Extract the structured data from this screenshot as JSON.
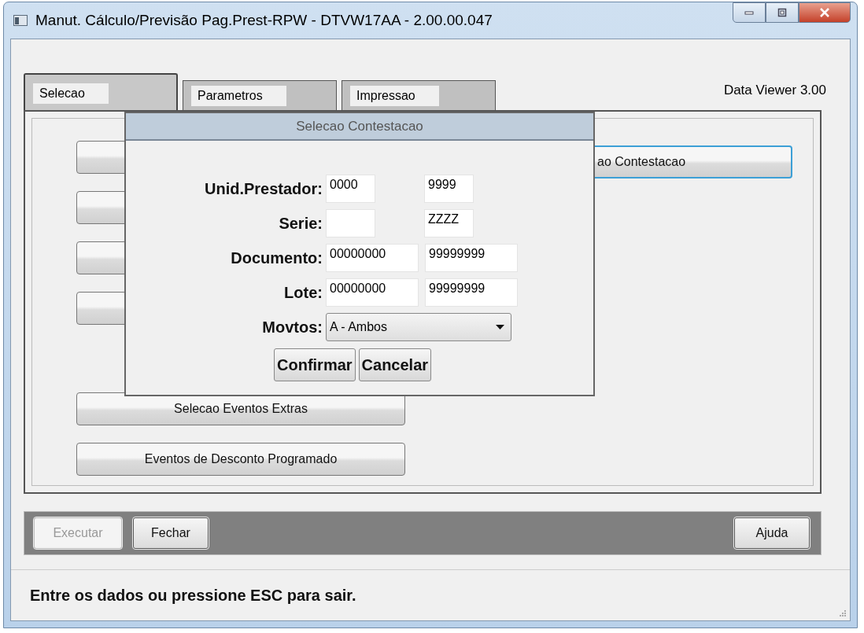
{
  "window": {
    "title": "Manut. Cálculo/Previsão Pag.Prest-RPW - DTVW17AA - 2.00.00.047"
  },
  "tabs": [
    {
      "label": "Selecao",
      "selected": true
    },
    {
      "label": "Parametros",
      "selected": false
    },
    {
      "label": "Impressao",
      "selected": false
    }
  ],
  "version": "Data Viewer 3.00",
  "panel_buttons_left": [
    {
      "label": "Selecao Eventos Extras"
    },
    {
      "label": "Eventos de Desconto Programado"
    }
  ],
  "panel_button_right": {
    "label": "ao Contestacao",
    "focused": true
  },
  "dialog": {
    "title": "Selecao Contestacao",
    "fields": [
      {
        "label": "Unid.Prestador:",
        "from": "0000",
        "to": "9999"
      },
      {
        "label": "Serie:",
        "to": "ZZZZ"
      },
      {
        "label": "Documento:",
        "from": "00000000",
        "to": "99999999"
      },
      {
        "label": "Lote:",
        "from": "00000000",
        "to": "99999999"
      }
    ],
    "select": {
      "label": "Movtos:",
      "value": "A - Ambos"
    },
    "buttons": [
      {
        "label": "Confirmar"
      },
      {
        "label": "Cancelar"
      }
    ]
  },
  "toolbar": {
    "left": [
      {
        "label": "Executar",
        "disabled": true
      },
      {
        "label": "Fechar",
        "disabled": false
      }
    ],
    "right": [
      {
        "label": "Ajuda",
        "disabled": false
      }
    ]
  },
  "status_bar": "Entre os dados ou pressione ESC para sair."
}
